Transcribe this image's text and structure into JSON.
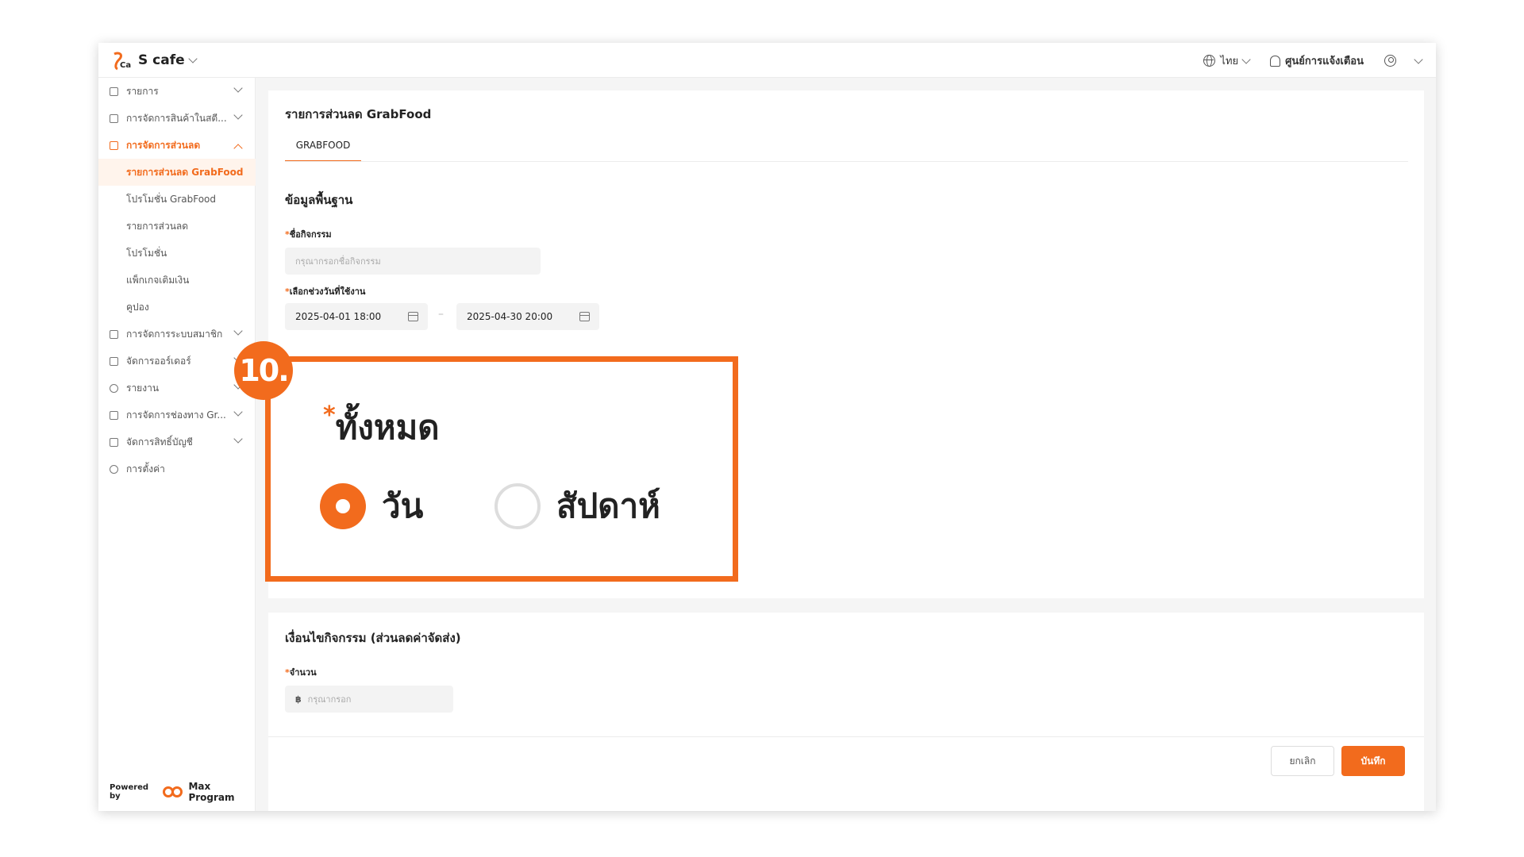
{
  "header": {
    "store_name": "S cafe",
    "language": "ไทย",
    "notification_center": "ศูนย์การแจ้งเตือน"
  },
  "sidebar": {
    "items": [
      {
        "label": "รายการ"
      },
      {
        "label": "การจัดการสินค้าในสตี..."
      },
      {
        "label": "การจัดการส่วนลด"
      },
      {
        "label": "รายการส่วนลด GrabFood"
      },
      {
        "label": "โปรโมชั่น GrabFood"
      },
      {
        "label": "รายการส่วนลด"
      },
      {
        "label": "โปรโมชั่น"
      },
      {
        "label": "แพ็กเกจเติมเงิน"
      },
      {
        "label": "คูปอง"
      },
      {
        "label": "การจัดการระบบสมาชิก"
      },
      {
        "label": "จัดการออร์เดอร์"
      },
      {
        "label": "รายงาน"
      },
      {
        "label": "การจัดการช่องทาง Gr..."
      },
      {
        "label": "จัดการสิทธิ์บัญชี"
      },
      {
        "label": "การตั้งค่า"
      }
    ],
    "powered_by": "Powered by",
    "brand": "Max Program"
  },
  "main": {
    "page_title": "รายการส่วนลด GrabFood",
    "tab": "GRABFOOD",
    "basic_info_title": "ข้อมูลพื้นฐาน",
    "activity_name_label": "ชื่อกิจกรรม",
    "activity_name_placeholder": "กรุณากรอกชื่อกิจกรรม",
    "date_range_label": "เลือกช่วงวันที่ใช้งาน",
    "date_start": "2025-04-01 18:00",
    "date_end": "2025-04-30 20:00",
    "conditions_title": "เงื่อนไขกิจกรรม (ส่วนลดค่าจัดส่ง)",
    "amount_label": "จำนวน",
    "amount_currency": "฿",
    "amount_placeholder": "กรุณากรอก",
    "required_mark": "*"
  },
  "footer": {
    "cancel": "ยกเลิก",
    "save": "บันทึก"
  },
  "callout": {
    "step": "10.",
    "title": "ทั้งหมด",
    "option_day": "วัน",
    "option_week": "สัปดาห์",
    "selected": "วัน"
  },
  "colors": {
    "accent": "#f26b1d"
  }
}
